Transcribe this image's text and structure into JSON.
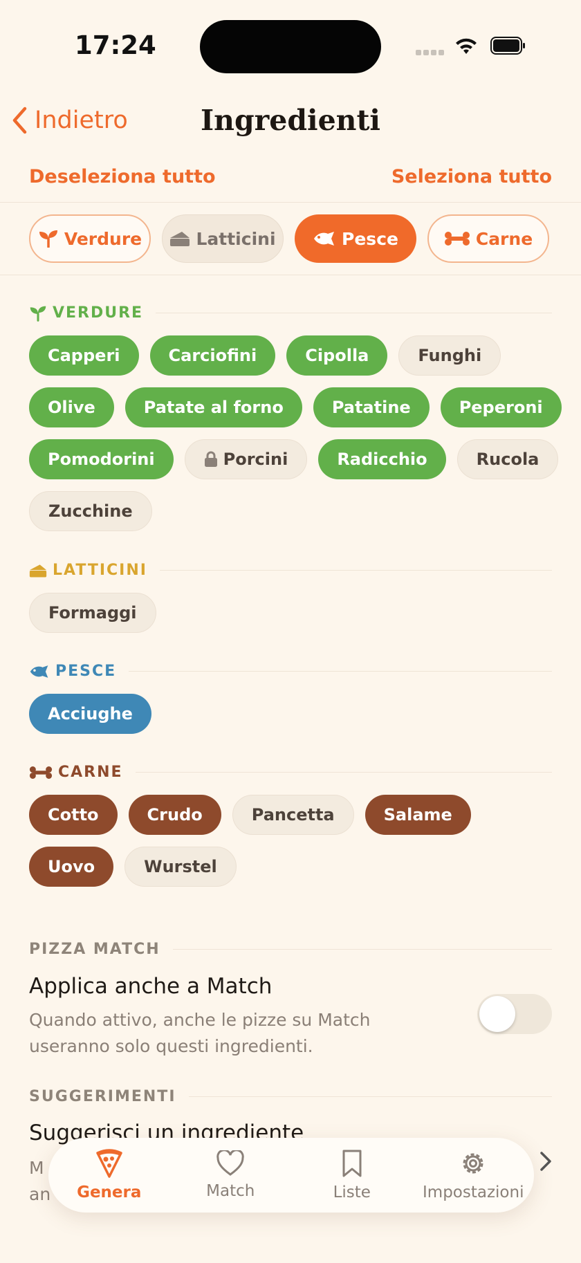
{
  "status_bar": {
    "time": "17:24"
  },
  "nav": {
    "back_label": "Indietro",
    "title": "Ingredienti"
  },
  "selection": {
    "deselect_all": "Deseleziona tutto",
    "select_all": "Seleziona tutto"
  },
  "filters": [
    {
      "label": "Verdure",
      "icon": "sprout-icon",
      "state": "outlined"
    },
    {
      "label": "Latticini",
      "icon": "cheese-icon",
      "state": "disabled"
    },
    {
      "label": "Pesce",
      "icon": "fish-icon",
      "state": "selected"
    },
    {
      "label": "Carne",
      "icon": "bone-icon",
      "state": "outlined"
    }
  ],
  "sections": {
    "verdure": {
      "title": "VERDURE",
      "color": "#62B04A",
      "items": [
        {
          "label": "Capperi",
          "selected": true
        },
        {
          "label": "Carciofini",
          "selected": true
        },
        {
          "label": "Cipolla",
          "selected": true
        },
        {
          "label": "Funghi",
          "selected": false
        },
        {
          "label": "Olive",
          "selected": true
        },
        {
          "label": "Patate al forno",
          "selected": true
        },
        {
          "label": "Patatine",
          "selected": true
        },
        {
          "label": "Peperoni",
          "selected": true
        },
        {
          "label": "Pomodorini",
          "selected": true
        },
        {
          "label": "Porcini",
          "selected": false,
          "locked": true
        },
        {
          "label": "Radicchio",
          "selected": true
        },
        {
          "label": "Rucola",
          "selected": false
        },
        {
          "label": "Zucchine",
          "selected": false
        }
      ]
    },
    "latticini": {
      "title": "LATTICINI",
      "color": "#D9A52E",
      "items": [
        {
          "label": "Formaggi",
          "selected": false
        }
      ]
    },
    "pesce": {
      "title": "PESCE",
      "color": "#3F88B6",
      "items": [
        {
          "label": "Acciughe",
          "selected": true
        }
      ]
    },
    "carne": {
      "title": "CARNE",
      "color": "#8E4A2C",
      "items": [
        {
          "label": "Cotto",
          "selected": true
        },
        {
          "label": "Crudo",
          "selected": true
        },
        {
          "label": "Pancetta",
          "selected": false
        },
        {
          "label": "Salame",
          "selected": true
        },
        {
          "label": "Uovo",
          "selected": true
        },
        {
          "label": "Wurstel",
          "selected": false
        }
      ]
    }
  },
  "pizza_match": {
    "group_title": "PIZZA MATCH",
    "setting_title": "Applica anche a Match",
    "setting_desc": "Quando attivo, anche le pizze su Match useranno solo questi ingredienti.",
    "toggle_on": false
  },
  "suggestions": {
    "group_title": "SUGGERIMENTI",
    "title": "Suggerisci un ingrediente",
    "desc_line1": "M",
    "desc_line2": "an"
  },
  "tabbar": {
    "tabs": [
      {
        "label": "Genera",
        "icon": "pizza-icon",
        "active": true
      },
      {
        "label": "Match",
        "icon": "heart-icon",
        "active": false
      },
      {
        "label": "Liste",
        "icon": "bookmark-icon",
        "active": false
      },
      {
        "label": "Impostazioni",
        "icon": "gear-icon",
        "active": false
      }
    ]
  },
  "colors": {
    "accent": "#EE6A2C",
    "background": "#FDF6EC",
    "veg": "#62B04A",
    "fish": "#3F88B6",
    "meat": "#8E4A2C",
    "dairy": "#D9A52E"
  }
}
